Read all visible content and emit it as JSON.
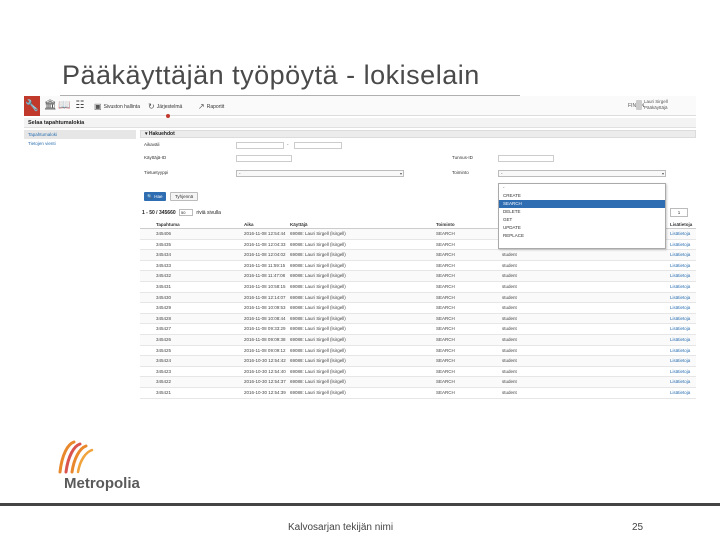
{
  "slide": {
    "title": "Pääkäyttäjän työpöytä - lokiselain",
    "footer_text": "Kalvosarjan tekijän nimi",
    "page_number": "25",
    "logo_text": "Metropolia"
  },
  "app": {
    "menus": [
      "Sivuston hallinta",
      "Järjestelmä",
      "Raportit"
    ],
    "language": "FIN EN",
    "user_name": "Lauri Sirgell",
    "user_role": "Pääkäyttäjä",
    "page_heading": "Selaa tapahtumalokia",
    "sidebar": [
      {
        "label": "Tapahtumaloki",
        "active": true
      },
      {
        "label": "Tietojen vienti",
        "active": false
      }
    ],
    "filters": {
      "panel_title": "Hakuehdot",
      "aikaväli_label": "Aikaväli",
      "kayttaja_label": "Käyttäjä-ID",
      "tietue_label": "Tietuetyyppi",
      "tietue_value": "-",
      "tunnus_label": "Tunnus-ID",
      "toiminto_label": "Toiminto",
      "toiminto_value": "-",
      "dash": "-"
    },
    "dropdown_options": [
      "-",
      "CREATE",
      "SEARCH",
      "DELETE",
      "GET",
      "UPDATE",
      "REPLACE"
    ],
    "dropdown_highlight": "SEARCH",
    "search_button": "Hae",
    "clear_button": "Tyhjennä",
    "pager": {
      "range": "1 - 50 / 345660",
      "per_page": "50",
      "per_page_label": "riviä sivulla",
      "page": "1"
    },
    "columns": [
      "Tapahtuma",
      "Aika",
      "Käyttäjä",
      "Toiminto",
      "Kohde",
      "Lisätietoja"
    ],
    "rows": [
      [
        "345406",
        "2016-11-08 12:54:44",
        "69088: Lauri Sirgell (lsirgell)",
        "SEARCH",
        "",
        "Lisätietoja"
      ],
      [
        "345435",
        "2016-11-08 12:04:33",
        "69088: Lauri Sirgell (lsirgell)",
        "SEARCH",
        "",
        "Lisätietoja"
      ],
      [
        "345434",
        "2016-11-08 12:04:02",
        "69088: Lauri Sirgell (lsirgell)",
        "SEARCH",
        "student",
        "Lisätietoja"
      ],
      [
        "345433",
        "2016-11-08 11:59:15",
        "69088: Lauri Sirgell (lsirgell)",
        "SEARCH",
        "student",
        "Lisätietoja"
      ],
      [
        "345432",
        "2016-11-08 11:47:08",
        "69088: Lauri Sirgell (lsirgell)",
        "SEARCH",
        "student",
        "Lisätietoja"
      ],
      [
        "345431",
        "2016-11-08 10:58:15",
        "69088: Lauri Sirgell (lsirgell)",
        "SEARCH",
        "student",
        "Lisätietoja"
      ],
      [
        "345430",
        "2016-11-08 12:14:07",
        "69088: Lauri Sirgell (lsirgell)",
        "SEARCH",
        "student",
        "Lisätietoja"
      ],
      [
        "345429",
        "2016-11-08 10:09:53",
        "69088: Lauri Sirgell (lsirgell)",
        "SEARCH",
        "student",
        "Lisätietoja"
      ],
      [
        "345428",
        "2016-11-08 10:08:44",
        "69088: Lauri Sirgell (lsirgell)",
        "SEARCH",
        "student",
        "Lisätietoja"
      ],
      [
        "345427",
        "2016-11-08 09:33:29",
        "69088: Lauri Sirgell (lsirgell)",
        "SEARCH",
        "student",
        "Lisätietoja"
      ],
      [
        "345426",
        "2016-11-08 09:09:38",
        "69088: Lauri Sirgell (lsirgell)",
        "SEARCH",
        "student",
        "Lisätietoja"
      ],
      [
        "345425",
        "2016-11-08 09:09:12",
        "69088: Lauri Sirgell (lsirgell)",
        "SEARCH",
        "student",
        "Lisätietoja"
      ],
      [
        "345424",
        "2016-10-30 12:54:42",
        "69088: Lauri Sirgell (lsirgell)",
        "SEARCH",
        "student",
        "Lisätietoja"
      ],
      [
        "345423",
        "2016-10-30 12:54:40",
        "69088: Lauri Sirgell (lsirgell)",
        "SEARCH",
        "student",
        "Lisätietoja"
      ],
      [
        "345422",
        "2016-10-30 12:54:37",
        "69088: Lauri Sirgell (lsirgell)",
        "SEARCH",
        "student",
        "Lisätietoja"
      ],
      [
        "345421",
        "2016-10-30 12:54:39",
        "69088: Lauri Sirgell (lsirgell)",
        "SEARCH",
        "student",
        "Lisätietoja"
      ]
    ]
  },
  "colors": {
    "brand_red": "#c0392b",
    "accent_blue": "#2f6db3",
    "logo_orange": "#e8872b"
  }
}
